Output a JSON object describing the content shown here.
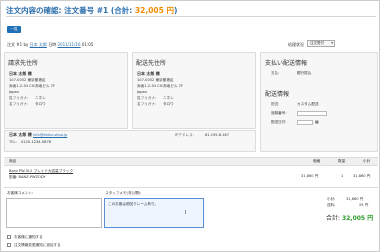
{
  "header": {
    "title": "注文内容の確認: 注文番号 #1",
    "total_label": "(合計: ",
    "total_amount": "32,005 円",
    "total_close": ")",
    "back_button": "一覧"
  },
  "order": {
    "number": "注文 #1 by",
    "customer_link": "日本 太郎",
    "date_prefix": "日時",
    "date_link": "2011/11/16",
    "time": "01:05",
    "status_label": "処理状況",
    "status_value": "注文受付"
  },
  "billing": {
    "title": "請求先住所",
    "name": "日本 太郎 様",
    "address1": "107-0052 東京都港区",
    "address2": "赤坂1-2-34 CIC赤坂ビル 7F",
    "country": "Japan",
    "kana_last_label": "姓フリガナ:",
    "kana_last": "ニホン",
    "kana_first_label": "名フリガナ:",
    "kana_first": "タロウ"
  },
  "shipping": {
    "title": "配送先住所",
    "name": "日本 太郎 様",
    "address1": "107-0052 東京都港区",
    "address2": "赤坂1-2-34 CIC赤坂ビル 7F",
    "country": "Japan",
    "kana_last_label": "姓フリガナ:",
    "kana_last": "ニホン",
    "kana_first_label": "名フリガナ:",
    "kana_first": "タロウ"
  },
  "payment": {
    "title": "支払い配送情報",
    "method_label": "支払:",
    "method_value": "銀行振込"
  },
  "delivery": {
    "title": "配送情報",
    "method_label": "配送:",
    "method_value": "カスタム配送",
    "tracking_label": "追跡番号:",
    "date_label": "配送日付:"
  },
  "contact": {
    "name": "日本 太郎 様",
    "email": "info@ebisu-shop.jp",
    "ip_label": "IPアドレス:",
    "ip_value": "61.195.8.167",
    "tel_label": "TEL:",
    "tel_value": "0120-1234-5678"
  },
  "table": {
    "headers": [
      "商品",
      "価格",
      "数量",
      "小計"
    ],
    "rows": [
      {
        "product": "Banz PW-5L2 ブレイド大容量ブラック",
        "sku": "型番: BANZ-PWZODY",
        "price": "31,860 円",
        "qty": "1",
        "subtotal": "31,860 円"
      }
    ]
  },
  "comments": {
    "customer_label": "お客様コメント:",
    "staff_label": "スタッフメモ(非公開):",
    "staff_value": "このお客は前回クレーム有り。"
  },
  "totals": {
    "subtotal_label": "小計:",
    "subtotal_value": "31,860 円",
    "shipping_label": "送料:",
    "shipping_value": "25 円",
    "grand_label": "合計:",
    "grand_value": "32,005 円"
  },
  "checks": {
    "notify_customer": "お客様に通知する",
    "append_comment": "注文情報変更通知に追加する"
  }
}
